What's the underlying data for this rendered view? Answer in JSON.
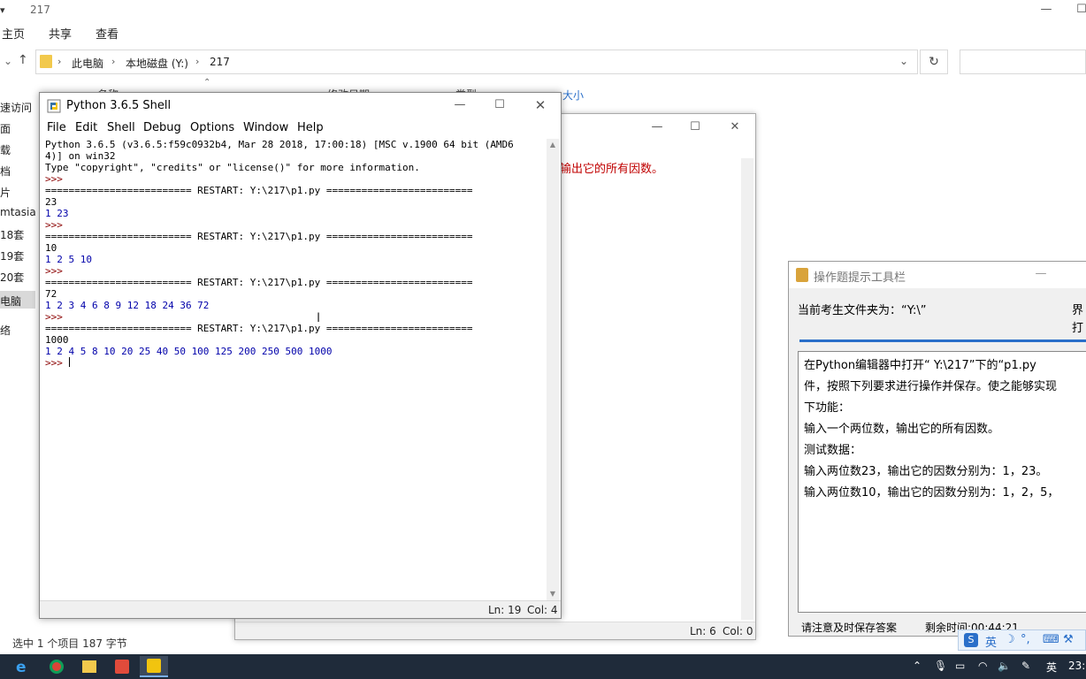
{
  "explorer": {
    "title": "217",
    "ribbon": [
      "主页",
      "共享",
      "查看"
    ],
    "breadcrumb": [
      "此电脑",
      "本地磁盘 (Y:)",
      "217"
    ],
    "columns": [
      "名称",
      "修改日期",
      "类型",
      "大小"
    ],
    "nav_items": [
      "速访问",
      "面",
      "载",
      "档",
      "片",
      "mtasia",
      "18套",
      "19套",
      "20套",
      "电脑",
      "络"
    ],
    "status": "选中 1 个项目  187 字节"
  },
  "editor": {
    "visible_text": "输出它的所有因数。",
    "status_ln": "Ln: 6",
    "status_col": "Col: 0"
  },
  "shell": {
    "title": "Python 3.6.5 Shell",
    "menu": [
      "File",
      "Edit",
      "Shell",
      "Debug",
      "Options",
      "Window",
      "Help"
    ],
    "lines": [
      {
        "t": "Python 3.6.5 (v3.6.5:f59c0932b4, Mar 28 2018, 17:00:18) [MSC v.1900 64 bit (AMD6",
        "c": "restart"
      },
      {
        "t": "4)] on win32",
        "c": "restart"
      },
      {
        "t": "Type \"copyright\", \"credits\" or \"license()\" for more information.",
        "c": "restart"
      },
      {
        "t": ">>> ",
        "c": "prompt"
      },
      {
        "t": "========================= RESTART: Y:\\217\\p1.py =========================",
        "c": "restart"
      },
      {
        "t": "23",
        "c": "restart"
      },
      {
        "t": "1 23",
        "c": "out"
      },
      {
        "t": ">>> ",
        "c": "prompt"
      },
      {
        "t": "========================= RESTART: Y:\\217\\p1.py =========================",
        "c": "restart"
      },
      {
        "t": "10",
        "c": "restart"
      },
      {
        "t": "1 2 5 10",
        "c": "out"
      },
      {
        "t": ">>> ",
        "c": "prompt"
      },
      {
        "t": "========================= RESTART: Y:\\217\\p1.py =========================",
        "c": "restart"
      },
      {
        "t": "72",
        "c": "restart"
      },
      {
        "t": "1 2 3 4 6 8 9 12 18 24 36 72",
        "c": "out"
      },
      {
        "t": ">>> ",
        "c": "prompt"
      },
      {
        "t": "========================= RESTART: Y:\\217\\p1.py =========================",
        "c": "restart"
      },
      {
        "t": "1000",
        "c": "restart"
      },
      {
        "t": "1 2 4 5 8 10 20 25 40 50 100 125 200 250 500 1000",
        "c": "out"
      },
      {
        "t": ">>> ",
        "c": "prompt"
      }
    ],
    "status_ln": "Ln: 19",
    "status_col": "Col: 4"
  },
  "hint": {
    "title": "操作题提示工具栏",
    "folder_label": "当前考生文件夹为：“Y:\\”",
    "right_text_1": "界",
    "right_text_2": "打",
    "content": [
      "在Python编辑器中打开“ Y:\\217”下的“p1.py",
      "件，按照下列要求进行操作并保存。使之能够实现",
      "下功能：",
      "输入一个两位数，输出它的所有因数。",
      "测试数据：",
      "输入两位数23，输出它的因数分别为：1，23。",
      "输入两位数10，输出它的因数分别为：1，2，5，"
    ],
    "save_note": "请注意及时保存答案",
    "timer": "剩余时间:00:44:21"
  },
  "ime": {
    "lang": "英"
  },
  "taskbar": {
    "lang": "英",
    "clock": "23:"
  },
  "colors": {
    "prompt": "#8b0000",
    "output": "#0000aa",
    "taskbar": "#1f2b3a",
    "accent": "#2a6fc9"
  }
}
